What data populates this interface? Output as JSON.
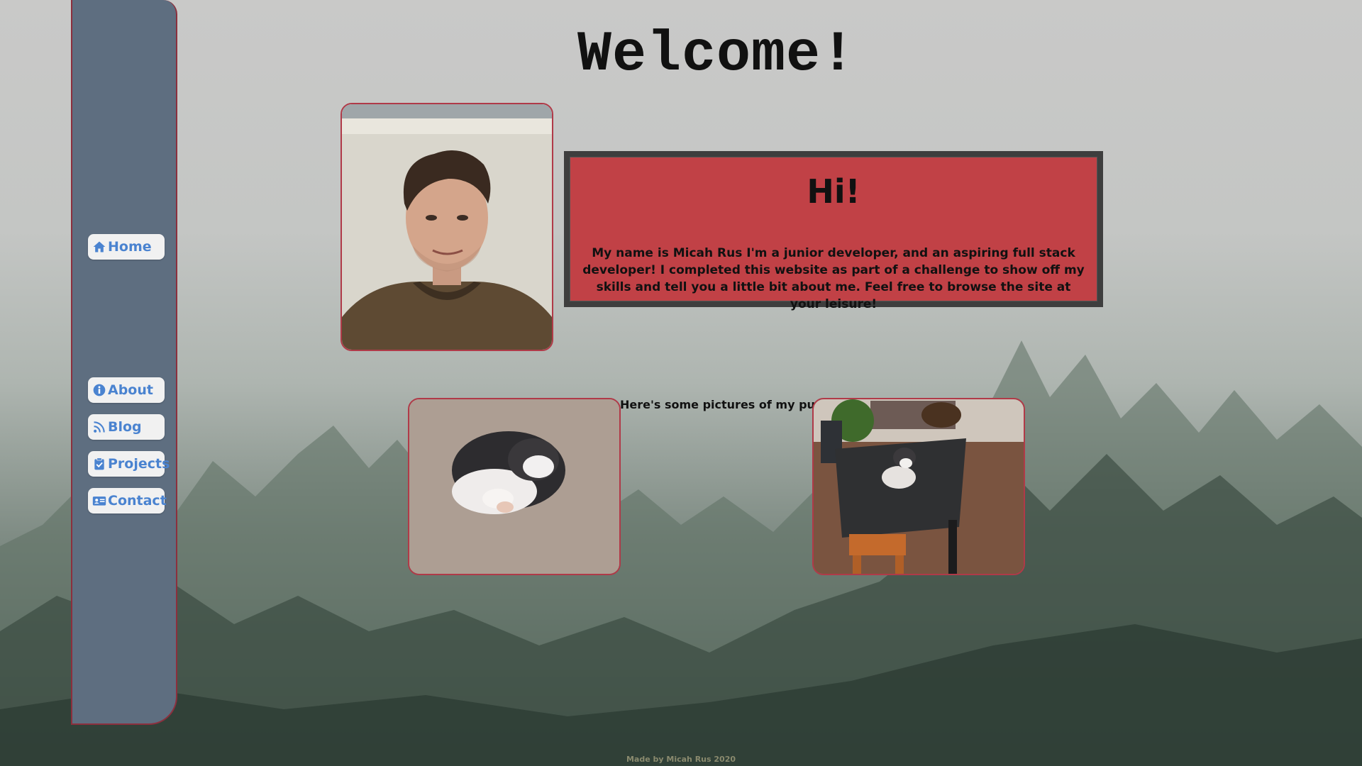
{
  "page": {
    "title": "Welcome!",
    "footer": "Made by Micah Rus 2020"
  },
  "nav": {
    "items": [
      {
        "label": "Home",
        "icon": "home-icon"
      },
      {
        "label": "About",
        "icon": "info-icon"
      },
      {
        "label": "Blog",
        "icon": "rss-icon"
      },
      {
        "label": "Projects",
        "icon": "clipboard-check-icon"
      },
      {
        "label": "Contact",
        "icon": "address-card-icon"
      }
    ]
  },
  "intro": {
    "heading": "Hi!",
    "text": "My name is Micah Rus I'm a junior developer, and an aspiring full stack developer! I completed this website as part of a challenge to show off my skills and tell you a little bit about me. Feel free to browse the site at your leisure!"
  },
  "puppy": {
    "caption": "Here's some pictures of my puppy :)"
  },
  "colors": {
    "sidebar": "#5e6e80",
    "accent_border": "#b03a48",
    "intro_bg": "#c14146",
    "nav_text": "#4a83d0"
  }
}
